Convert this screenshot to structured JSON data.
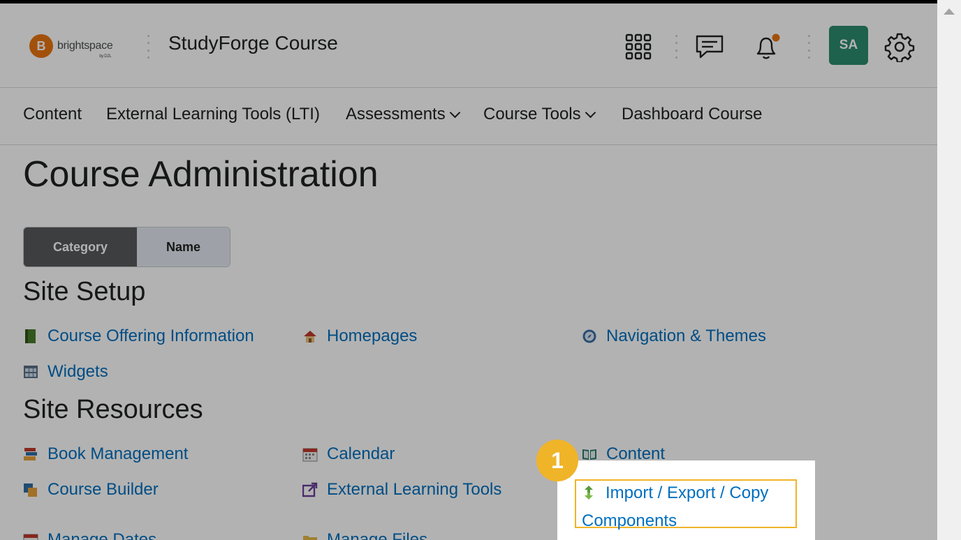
{
  "header": {
    "brand": "brightspace",
    "brand_sub": "by D2L",
    "course_title": "StudyForge Course",
    "avatar_initials": "SA"
  },
  "nav": {
    "items": [
      {
        "label": "Content"
      },
      {
        "label": "External Learning Tools (LTI)"
      },
      {
        "label": "Assessments"
      },
      {
        "label": "Course Tools"
      },
      {
        "label": "Dashboard Course"
      }
    ]
  },
  "page": {
    "title": "Course Administration",
    "toggle": {
      "category": "Category",
      "name": "Name"
    }
  },
  "sections": {
    "site_setup": {
      "heading": "Site Setup",
      "links": [
        "Course Offering Information",
        "Homepages",
        "Navigation & Themes",
        "Widgets"
      ]
    },
    "site_resources": {
      "heading": "Site Resources",
      "links": [
        "Book Management",
        "Calendar",
        "Content",
        "Course Builder",
        "External Learning Tools",
        "Import / Export / Copy Components",
        "Manage Dates",
        "Manage Files"
      ]
    }
  },
  "walkthrough": {
    "step": "1",
    "highlighted_link": "Import / Export / Copy Components"
  },
  "colors": {
    "link": "#006fbf",
    "highlight": "#f0b429",
    "avatar": "#2b8b6e",
    "brand": "#e87511"
  }
}
